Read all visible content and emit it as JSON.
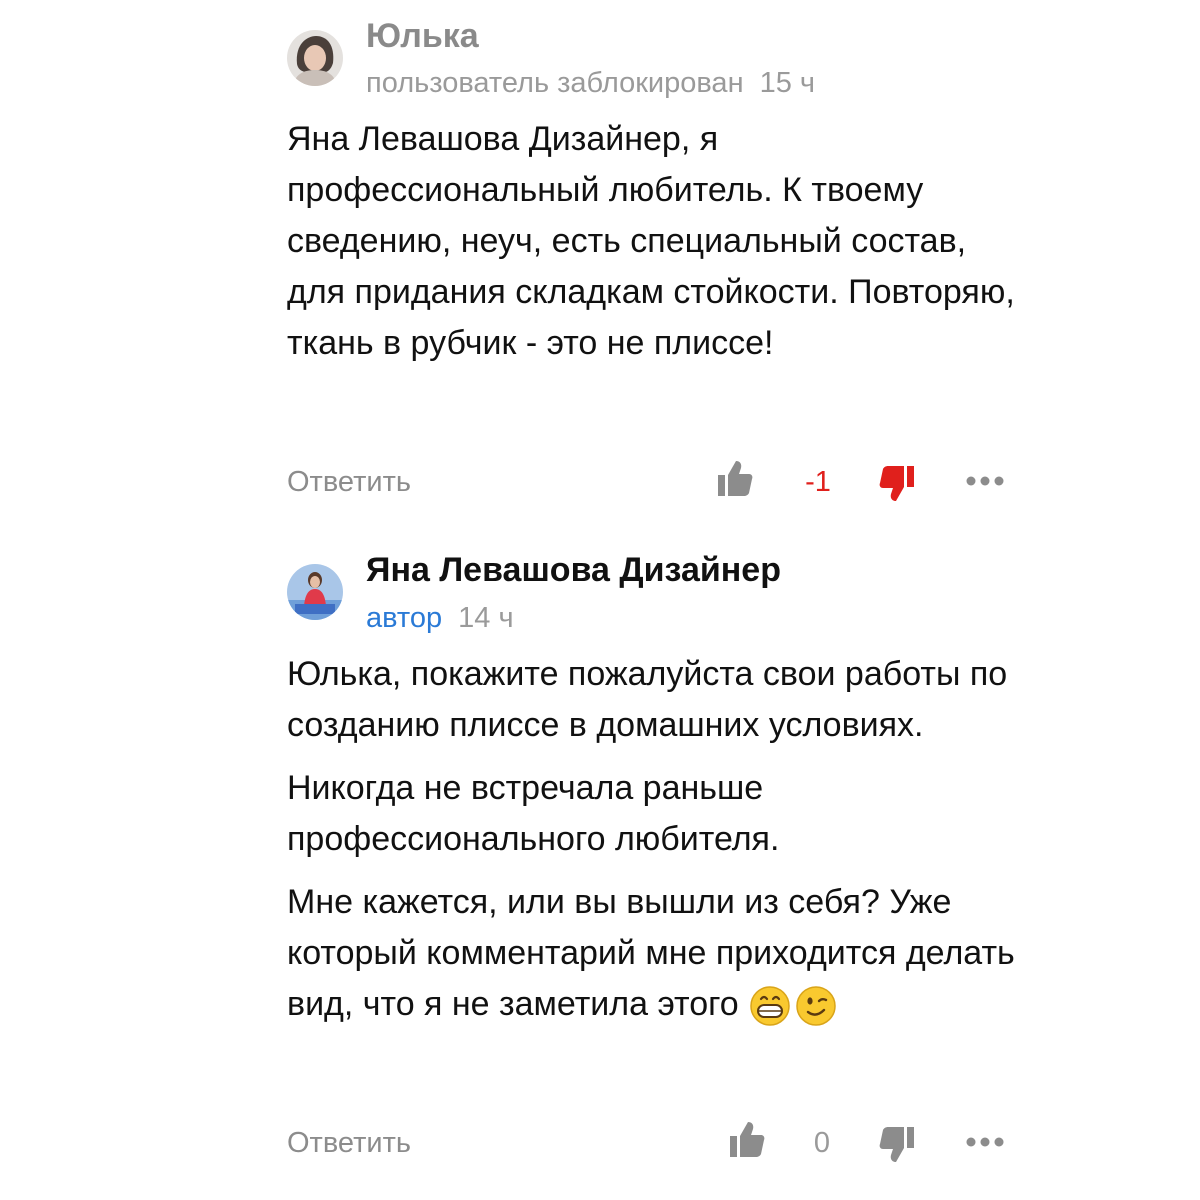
{
  "comments": [
    {
      "author": "Юлька",
      "status": "пользователь заблокирован",
      "time": "15 ч",
      "paragraphs": [
        "Яна Левашова Дизайнер, я профессиональный любитель. К твоему сведению, неуч, есть специальный состав, для придания складкам стойкости. Повторяю, ткань в рубчик - это не плиссе!"
      ],
      "reply_label": "Ответить",
      "score": "-1",
      "score_color": "#e0201c",
      "dislike_color": "#e0201c",
      "like_icon": "thumb-up-icon",
      "dislike_icon": "thumb-down-icon",
      "more_icon": "more-dots-icon"
    },
    {
      "author": "Яна Левашова Дизайнер",
      "status": "автор",
      "status_color": "#2a7ad6",
      "time": "14 ч",
      "paragraphs": [
        "Юлька, покажите пожалуйста свои работы по созданию плиссе в домашних условиях.",
        "Никогда не встречала раньше профессионального любителя.",
        "Мне кажется, или вы вышли из себя? Уже который комментарий мне приходится делать вид, что я не заметила этого"
      ],
      "emojis": [
        "grinning-face-emoji",
        "winking-face-emoji"
      ],
      "reply_label": "Ответить",
      "score": "0",
      "score_color": "#9a9a9a",
      "dislike_color": "#8c8c8c",
      "like_icon": "thumb-up-icon",
      "dislike_icon": "thumb-down-icon",
      "more_icon": "more-dots-icon"
    }
  ]
}
